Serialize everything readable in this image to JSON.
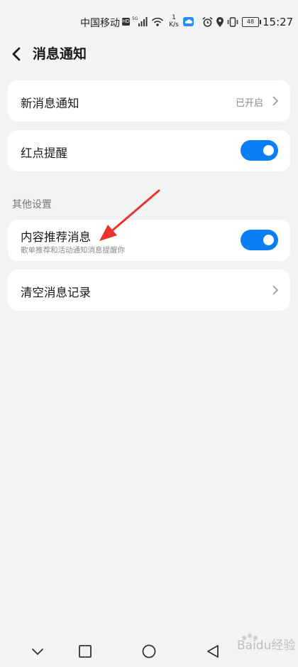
{
  "status_bar": {
    "carrier": "中国移动",
    "hd_badge": "HD",
    "net_type": "5G",
    "speed_value": "1",
    "speed_unit": "K/s",
    "battery": "48",
    "time": "15:27"
  },
  "header": {
    "title": "消息通知"
  },
  "settings": {
    "new_message": {
      "label": "新消息通知",
      "value": "已开启"
    },
    "red_dot": {
      "label": "红点提醒",
      "enabled": true
    },
    "section_other": "其他设置",
    "recommend": {
      "label": "内容推荐消息",
      "sublabel": "歌单推荐和活动通知消息提醒你",
      "enabled": true
    },
    "clear_history": {
      "label": "清空消息记录"
    }
  },
  "colors": {
    "background": "#f1f3f5",
    "card": "#ffffff",
    "toggle_on": "#0a7ef3",
    "annotation": "#e8342b"
  },
  "icons": {
    "back": "chevron-left-icon",
    "nav_back": "triangle-back-icon",
    "nav_home": "circle-home-icon",
    "nav_recent": "square-recent-icon",
    "nav_hide": "chevron-down-icon"
  },
  "watermark": "Baidu经验"
}
